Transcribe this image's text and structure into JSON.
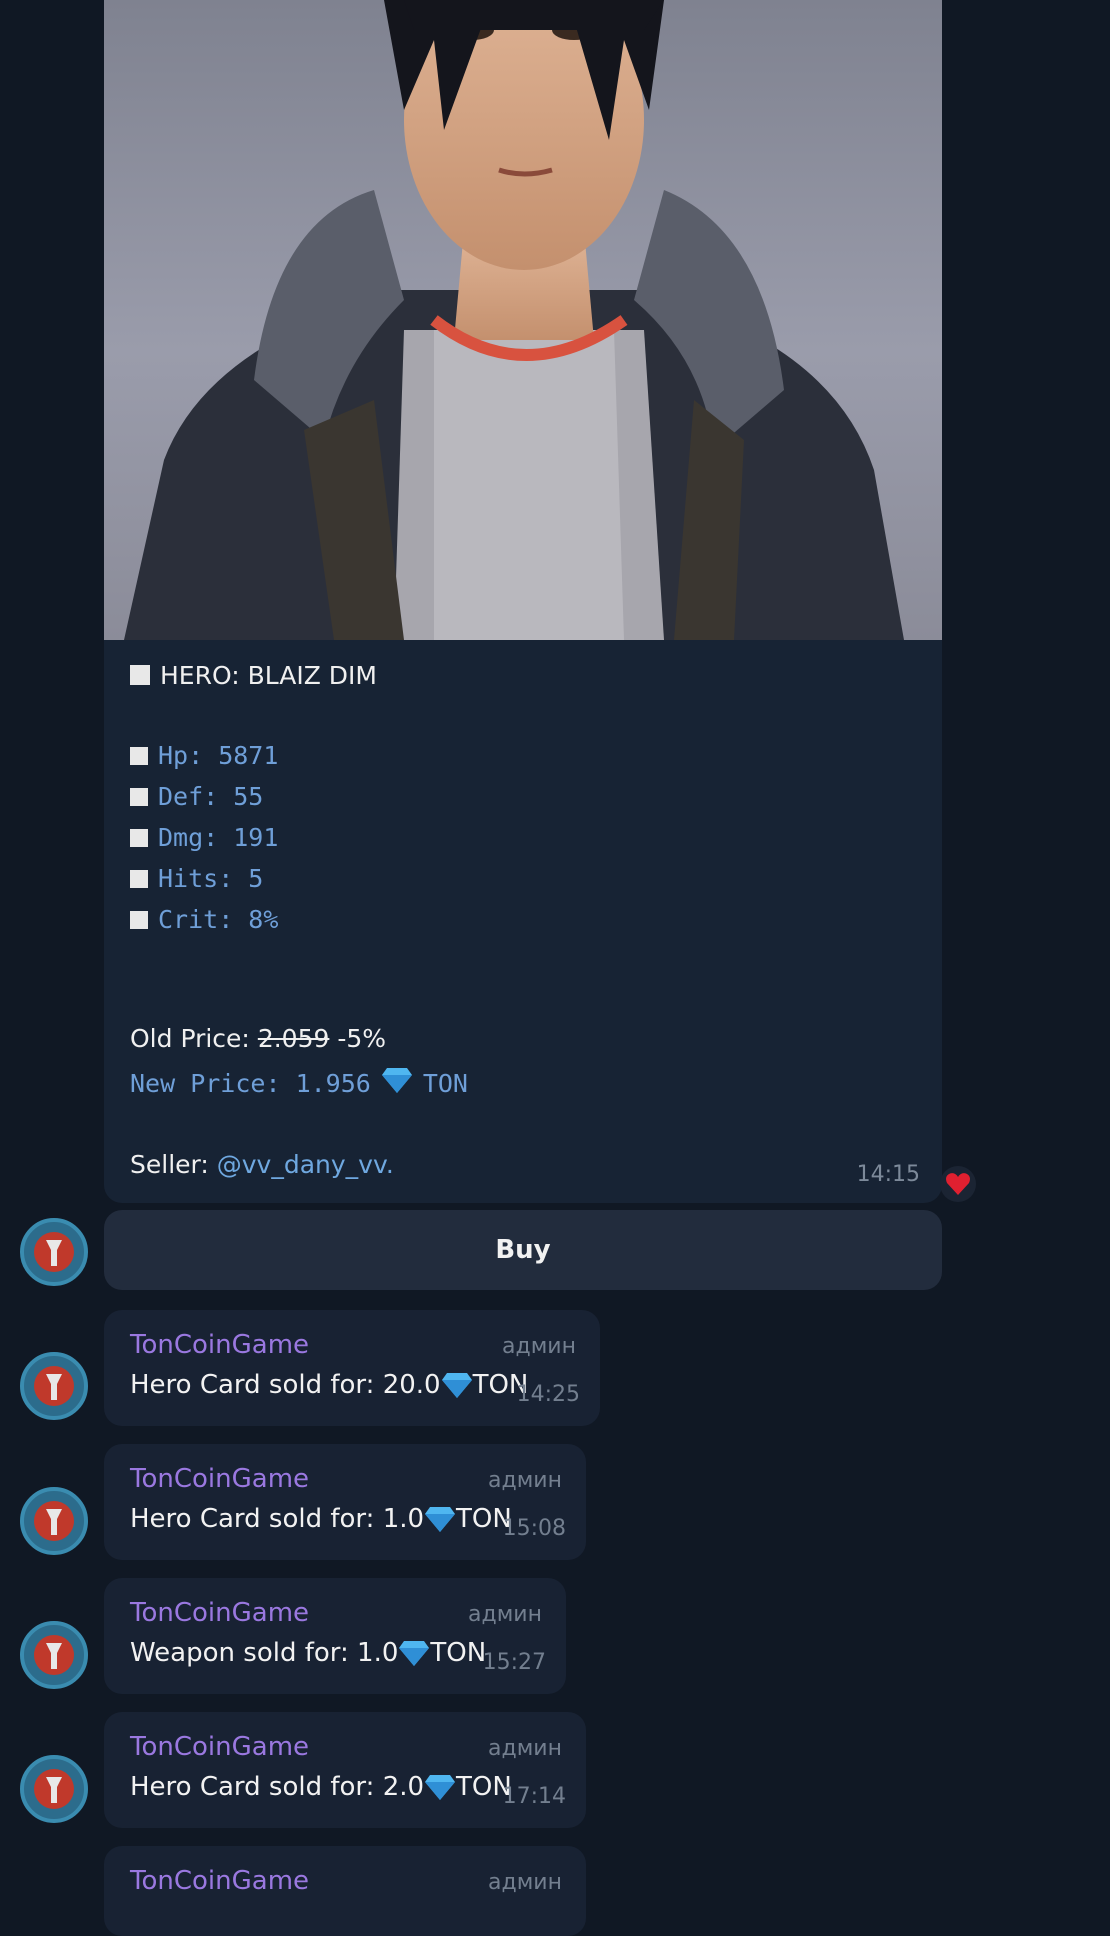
{
  "card": {
    "hero_line": "HERO: BLAIZ DIM",
    "stats": [
      "Hp: 5871",
      "Def: 55",
      "Dmg: 191",
      "Hits: 5",
      "Crit: 8%"
    ],
    "old_price_label": "Old Price:",
    "old_price_value": "2.059",
    "discount": "-5%",
    "new_price_label": "New Price: 1.956",
    "currency": "TON",
    "seller_label": "Seller:",
    "seller_handle": "@vv_dany_vv.",
    "time": "14:15"
  },
  "buy_label": "Buy",
  "messages": [
    {
      "sender": "TonCoinGame",
      "role": "админ",
      "text": "Hero Card sold for: 20.0",
      "currency": "TON",
      "time": "14:25"
    },
    {
      "sender": "TonCoinGame",
      "role": "админ",
      "text": "Hero Card sold for: 1.0",
      "currency": "TON",
      "time": "15:08"
    },
    {
      "sender": "TonCoinGame",
      "role": "админ",
      "text": "Weapon sold for: 1.0",
      "currency": "TON",
      "time": "15:27"
    },
    {
      "sender": "TonCoinGame",
      "role": "админ",
      "text": "Hero Card sold for: 2.0",
      "currency": "TON",
      "time": "17:14"
    },
    {
      "sender": "TonCoinGame",
      "role": "админ"
    }
  ],
  "colors": {
    "background": "#101824",
    "bubble": "#182233",
    "sender": "#9a78e0",
    "link": "#6fa8e0",
    "heart": "#e02030"
  },
  "icons": [
    "gem-icon",
    "heart-icon",
    "bot-avatar-icon"
  ]
}
